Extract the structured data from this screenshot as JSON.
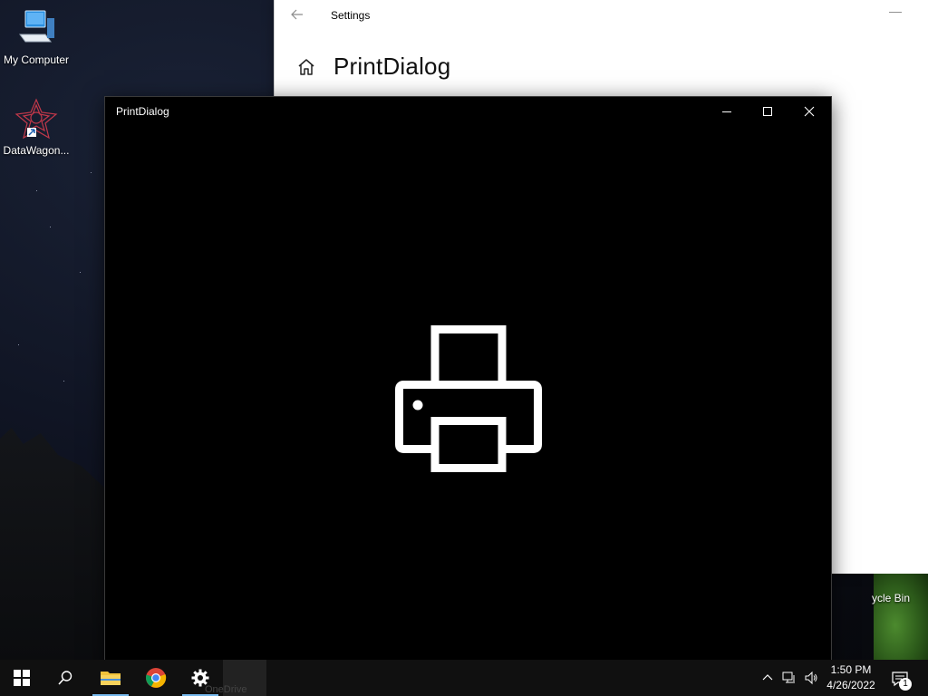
{
  "desktop": {
    "icons": [
      {
        "label": "My Computer",
        "icon": "computer-icon"
      },
      {
        "label": "DataWagon...",
        "icon": "datawagon-icon"
      }
    ],
    "recycle_bin_label": "ycle Bin"
  },
  "settings_window": {
    "title": "Settings",
    "page_heading": "PrintDialog",
    "back_icon": "back-arrow-icon",
    "home_icon": "home-icon",
    "minimize_glyph": "—"
  },
  "print_window": {
    "title": "PrintDialog",
    "center_icon": "printer-icon",
    "controls": [
      "minimize",
      "maximize",
      "close"
    ]
  },
  "taskbar": {
    "apps": [
      {
        "name": "start",
        "icon": "windows-logo-icon"
      },
      {
        "name": "search",
        "icon": "search-icon"
      },
      {
        "name": "file-explorer",
        "icon": "folder-icon"
      },
      {
        "name": "chrome",
        "icon": "chrome-icon"
      },
      {
        "name": "settings",
        "icon": "gear-icon"
      }
    ],
    "ghost_label": "OneDrive",
    "tray": {
      "chevron_glyph": "^",
      "network_icon": "network-icon",
      "volume_icon": "volume-icon"
    },
    "clock": {
      "time": "1:50 PM",
      "date": "4/26/2022"
    },
    "notifications": {
      "count": "1"
    }
  },
  "colors": {
    "accent": "#76b9ed",
    "taskbar": "#101010",
    "settings_bg": "#ffffff",
    "print_bg": "#000000"
  }
}
